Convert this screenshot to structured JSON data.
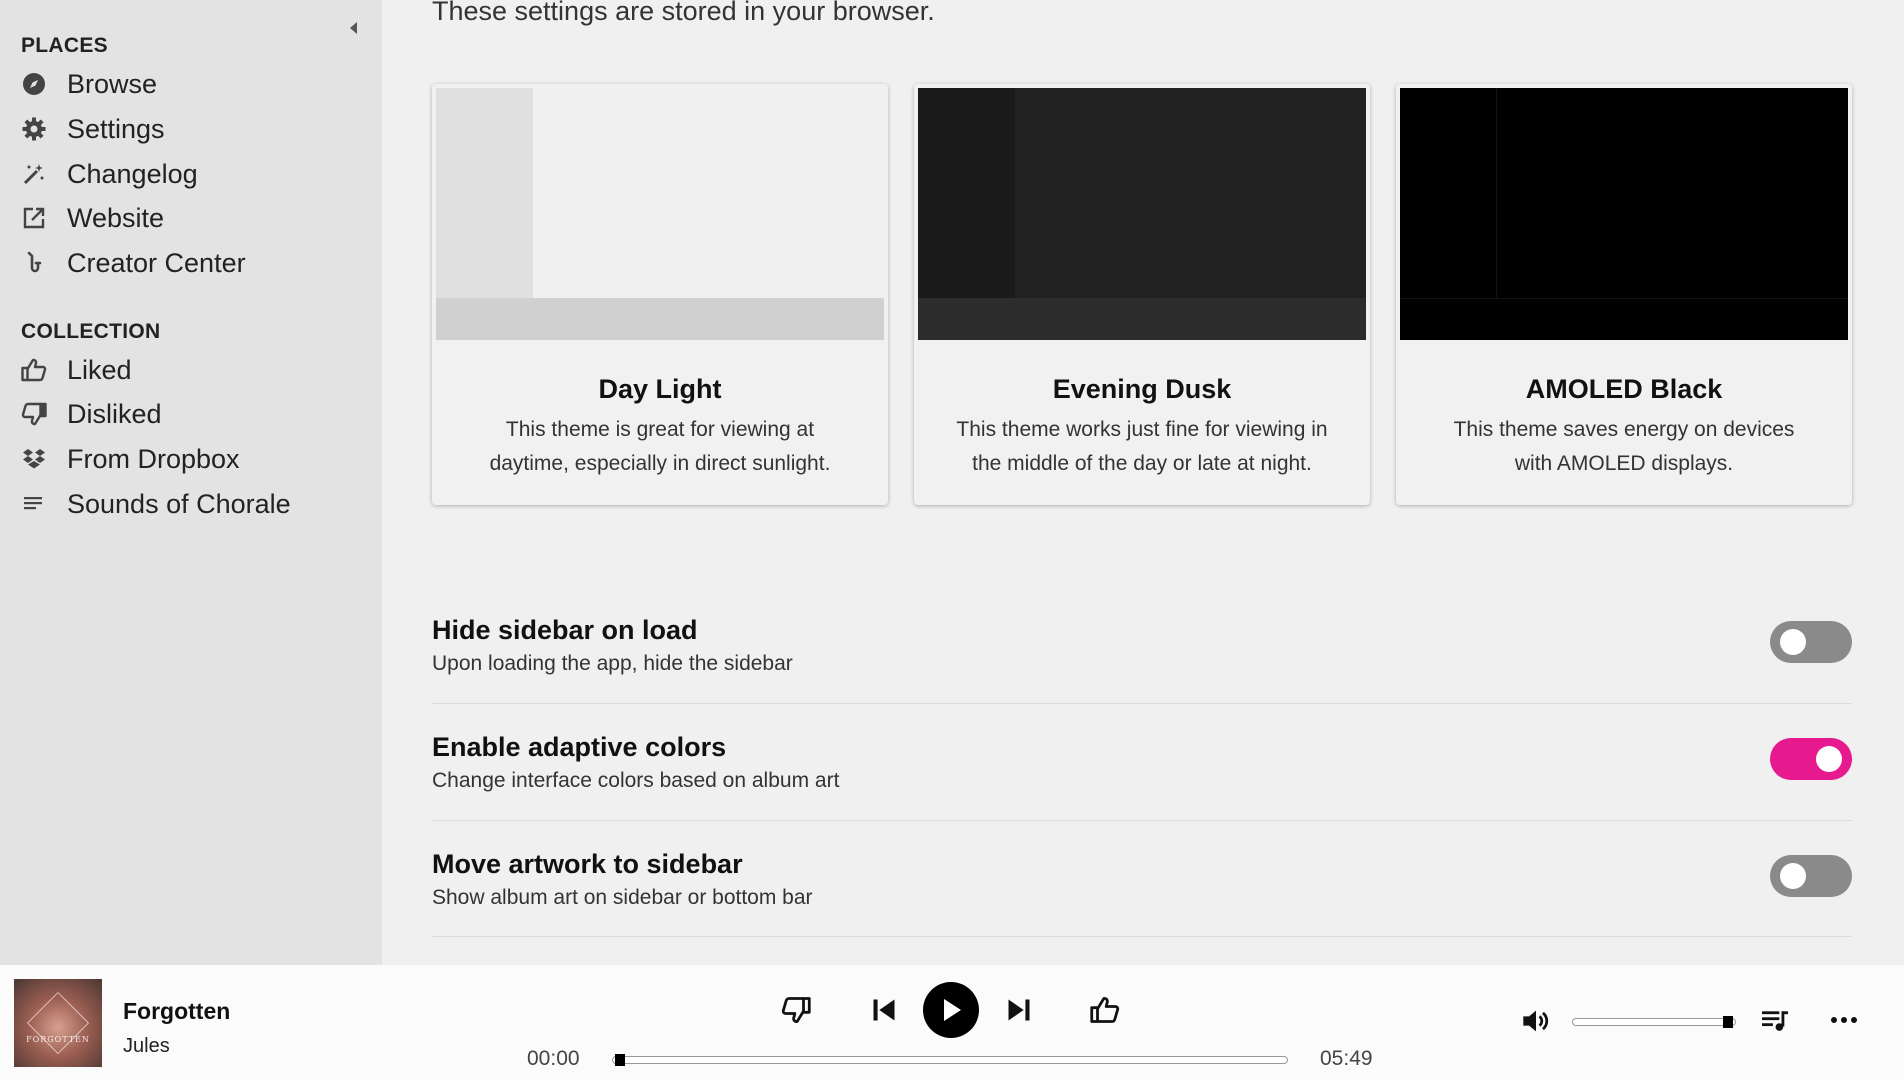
{
  "sidebar": {
    "places_title": "PLACES",
    "places": [
      {
        "label": "Browse",
        "icon": "compass-icon"
      },
      {
        "label": "Settings",
        "icon": "gear-icon"
      },
      {
        "label": "Changelog",
        "icon": "magic-wand-icon"
      },
      {
        "label": "Website",
        "icon": "external-link-icon"
      },
      {
        "label": "Creator Center",
        "icon": "saxophone-icon"
      }
    ],
    "collection_title": "COLLECTION",
    "collection": [
      {
        "label": "Liked",
        "icon": "thumbs-up-icon"
      },
      {
        "label": "Disliked",
        "icon": "thumbs-down-icon"
      },
      {
        "label": "From Dropbox",
        "icon": "dropbox-icon"
      },
      {
        "label": "Sounds of Chorale",
        "icon": "playlist-icon"
      }
    ]
  },
  "main": {
    "intro": "These settings are stored in your browser.",
    "themes": [
      {
        "title": "Day Light",
        "desc": "This theme is great for viewing at daytime, especially in direct sunlight.",
        "colors": {
          "side": "#e0e0e0",
          "main": "#f0f0f0",
          "bar": "#d0d0d0"
        }
      },
      {
        "title": "Evening Dusk",
        "desc": "This theme works just fine for viewing in the middle of the day or late at night.",
        "colors": {
          "side": "#1a1a1a",
          "main": "#222222",
          "bar": "#2c2c2c"
        }
      },
      {
        "title": "AMOLED Black",
        "desc": "This theme saves energy on devices with AMOLED displays.",
        "colors": {
          "side": "#000000",
          "main": "#000000",
          "bar": "#000000"
        }
      }
    ],
    "settings": [
      {
        "title": "Hide sidebar on load",
        "desc": "Upon loading the app, hide the sidebar",
        "enabled": false
      },
      {
        "title": "Enable adaptive colors",
        "desc": "Change interface colors based on album art",
        "enabled": true
      },
      {
        "title": "Move artwork to sidebar",
        "desc": "Show album art on sidebar or bottom bar",
        "enabled": false
      }
    ],
    "accent_color": "#e6198f"
  },
  "player": {
    "album_art_text": "FORGOTTEN",
    "title": "Forgotten",
    "artist": "Jules",
    "current_time": "00:00",
    "duration": "05:49",
    "progress": 0.0,
    "volume": 1.0
  }
}
